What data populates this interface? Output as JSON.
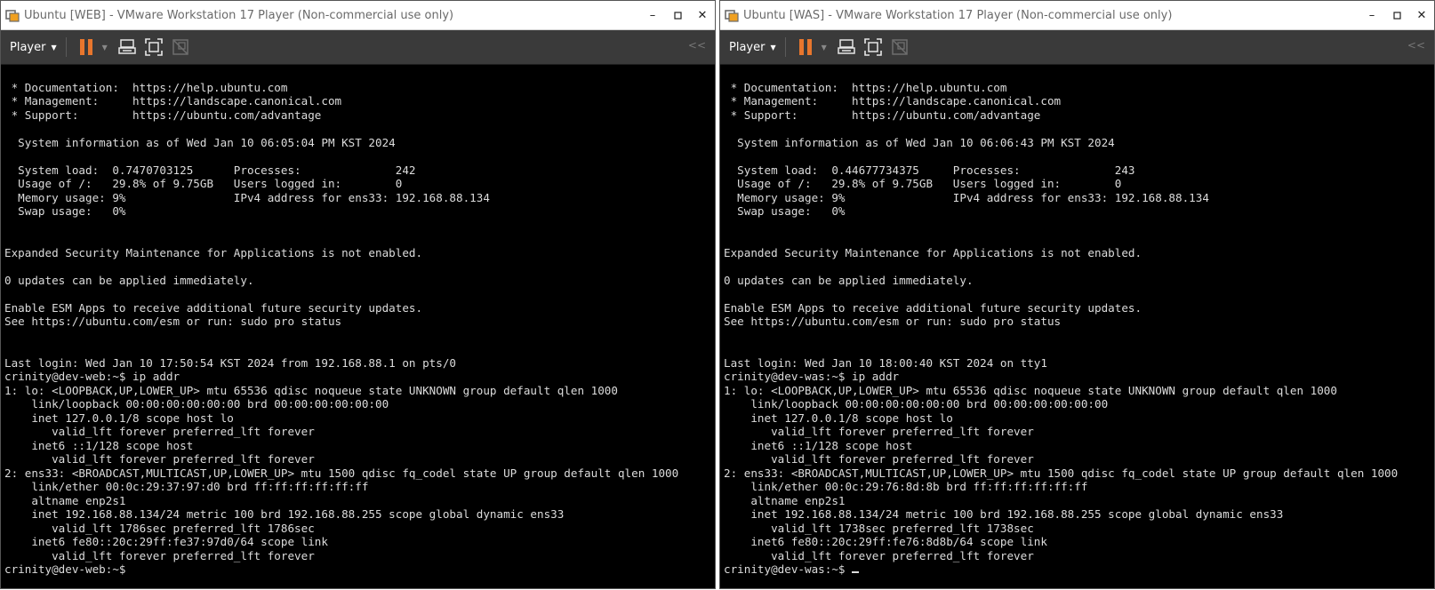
{
  "windows": [
    {
      "title": "Ubuntu [WEB] - VMware Workstation 17 Player (Non-commercial use only)",
      "player_label": "Player",
      "show_cursor": false,
      "lines": [
        "",
        " * Documentation:  https://help.ubuntu.com",
        " * Management:     https://landscape.canonical.com",
        " * Support:        https://ubuntu.com/advantage",
        "",
        "  System information as of Wed Jan 10 06:05:04 PM KST 2024",
        "",
        "  System load:  0.7470703125      Processes:              242",
        "  Usage of /:   29.8% of 9.75GB   Users logged in:        0",
        "  Memory usage: 9%                IPv4 address for ens33: 192.168.88.134",
        "  Swap usage:   0%",
        "",
        "",
        "Expanded Security Maintenance for Applications is not enabled.",
        "",
        "0 updates can be applied immediately.",
        "",
        "Enable ESM Apps to receive additional future security updates.",
        "See https://ubuntu.com/esm or run: sudo pro status",
        "",
        "",
        "Last login: Wed Jan 10 17:50:54 KST 2024 from 192.168.88.1 on pts/0",
        "crinity@dev-web:~$ ip addr",
        "1: lo: <LOOPBACK,UP,LOWER_UP> mtu 65536 qdisc noqueue state UNKNOWN group default qlen 1000",
        "    link/loopback 00:00:00:00:00:00 brd 00:00:00:00:00:00",
        "    inet 127.0.0.1/8 scope host lo",
        "       valid_lft forever preferred_lft forever",
        "    inet6 ::1/128 scope host",
        "       valid_lft forever preferred_lft forever",
        "2: ens33: <BROADCAST,MULTICAST,UP,LOWER_UP> mtu 1500 qdisc fq_codel state UP group default qlen 1000",
        "    link/ether 00:0c:29:37:97:d0 brd ff:ff:ff:ff:ff:ff",
        "    altname enp2s1",
        "    inet 192.168.88.134/24 metric 100 brd 192.168.88.255 scope global dynamic ens33",
        "       valid_lft 1786sec preferred_lft 1786sec",
        "    inet6 fe80::20c:29ff:fe37:97d0/64 scope link",
        "       valid_lft forever preferred_lft forever",
        "crinity@dev-web:~$"
      ]
    },
    {
      "title": "Ubuntu [WAS] - VMware Workstation 17 Player (Non-commercial use only)",
      "player_label": "Player",
      "show_cursor": true,
      "lines": [
        "",
        " * Documentation:  https://help.ubuntu.com",
        " * Management:     https://landscape.canonical.com",
        " * Support:        https://ubuntu.com/advantage",
        "",
        "  System information as of Wed Jan 10 06:06:43 PM KST 2024",
        "",
        "  System load:  0.44677734375     Processes:              243",
        "  Usage of /:   29.8% of 9.75GB   Users logged in:        0",
        "  Memory usage: 9%                IPv4 address for ens33: 192.168.88.134",
        "  Swap usage:   0%",
        "",
        "",
        "Expanded Security Maintenance for Applications is not enabled.",
        "",
        "0 updates can be applied immediately.",
        "",
        "Enable ESM Apps to receive additional future security updates.",
        "See https://ubuntu.com/esm or run: sudo pro status",
        "",
        "",
        "Last login: Wed Jan 10 18:00:40 KST 2024 on tty1",
        "crinity@dev-was:~$ ip addr",
        "1: lo: <LOOPBACK,UP,LOWER_UP> mtu 65536 qdisc noqueue state UNKNOWN group default qlen 1000",
        "    link/loopback 00:00:00:00:00:00 brd 00:00:00:00:00:00",
        "    inet 127.0.0.1/8 scope host lo",
        "       valid_lft forever preferred_lft forever",
        "    inet6 ::1/128 scope host",
        "       valid_lft forever preferred_lft forever",
        "2: ens33: <BROADCAST,MULTICAST,UP,LOWER_UP> mtu 1500 qdisc fq_codel state UP group default qlen 1000",
        "    link/ether 00:0c:29:76:8d:8b brd ff:ff:ff:ff:ff:ff",
        "    altname enp2s1",
        "    inet 192.168.88.134/24 metric 100 brd 192.168.88.255 scope global dynamic ens33",
        "       valid_lft 1738sec preferred_lft 1738sec",
        "    inet6 fe80::20c:29ff:fe76:8d8b/64 scope link",
        "       valid_lft forever preferred_lft forever",
        "crinity@dev-was:~$ "
      ]
    }
  ],
  "icons": {
    "app": "vmware-player-icon",
    "pause": "pause-icon",
    "send_keys": "send-ctrl-alt-del-icon",
    "fullscreen": "fullscreen-icon",
    "unity": "unity-mode-icon",
    "collapse": "collapse-toolbar-icon"
  },
  "colors": {
    "pause_accent": "#e8762d",
    "terminal_bg": "#000000",
    "terminal_fg": "#dcdcdc",
    "toolbar_bg": "#3a3a3a"
  }
}
